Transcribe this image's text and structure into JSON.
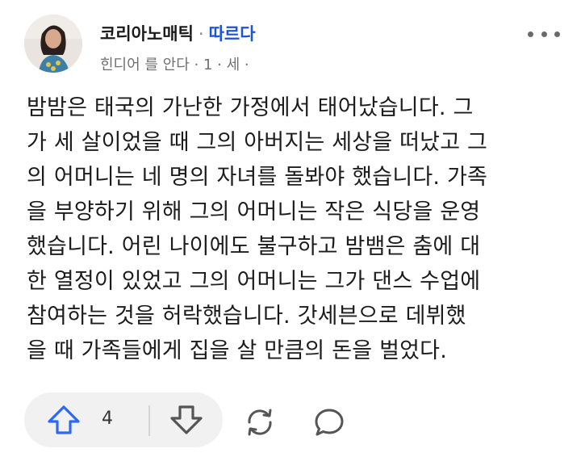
{
  "post": {
    "author": "코리아노매틱",
    "separator": "·",
    "follow_label": "따르다",
    "meta": "힌디어 를 안다 · 1 · 세 ·",
    "lines": [
      "밤밤은 태국의 가난한 가정에서 태어났습니다. 그",
      "가 세 살이었을 때 그의 아버지는 세상을 떠났고 그",
      "의 어머니는 네 명의 자녀를 돌봐야 했습니다. 가족",
      "을 부양하기 위해 그의 어머니는 작은 식당을 운영",
      "했습니다. 어린 나이에도 불구하고 밤뱀은 춤에 대",
      "한 열정이 있었고 그의 어머니는 그가 댄스 수업에",
      "참여하는 것을 허락했습니다. 갓세븐으로 데뷔했",
      "을 때 가족들에게 집을 살 만큼의 돈을 벌었다."
    ]
  },
  "actions": {
    "upvote_count": "4",
    "icons": [
      "upvote-arrow-icon",
      "downvote-arrow-icon",
      "share-repost-icon",
      "comment-bubble-icon"
    ]
  },
  "colors": {
    "accent": "#1b55d6",
    "upvote": "#2e69f5",
    "bar_bg": "#f1f1f1"
  }
}
